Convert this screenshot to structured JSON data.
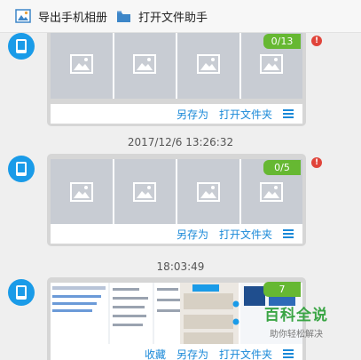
{
  "toolbar": {
    "export_label": "导出手机相册",
    "open_label": "打开文件助手"
  },
  "messages": [
    {
      "badge": "0/13",
      "actions": [
        "另存为",
        "打开文件夹"
      ],
      "has_error": true
    },
    {
      "timestamp": "2017/12/6 13:26:32",
      "badge": "0/5",
      "actions": [
        "另存为",
        "打开文件夹"
      ],
      "has_error": true
    },
    {
      "timestamp": "18:03:49",
      "badge": "7",
      "actions": [
        "收藏",
        "另存为",
        "打开文件夹"
      ],
      "has_error": false
    }
  ],
  "watermark": {
    "title": "百科全说",
    "subtitle": "助你轻松解决"
  },
  "colors": {
    "accent": "#1a89d8",
    "badge": "#66b832",
    "error": "#e0443a",
    "avatar": "#1a9be8"
  }
}
